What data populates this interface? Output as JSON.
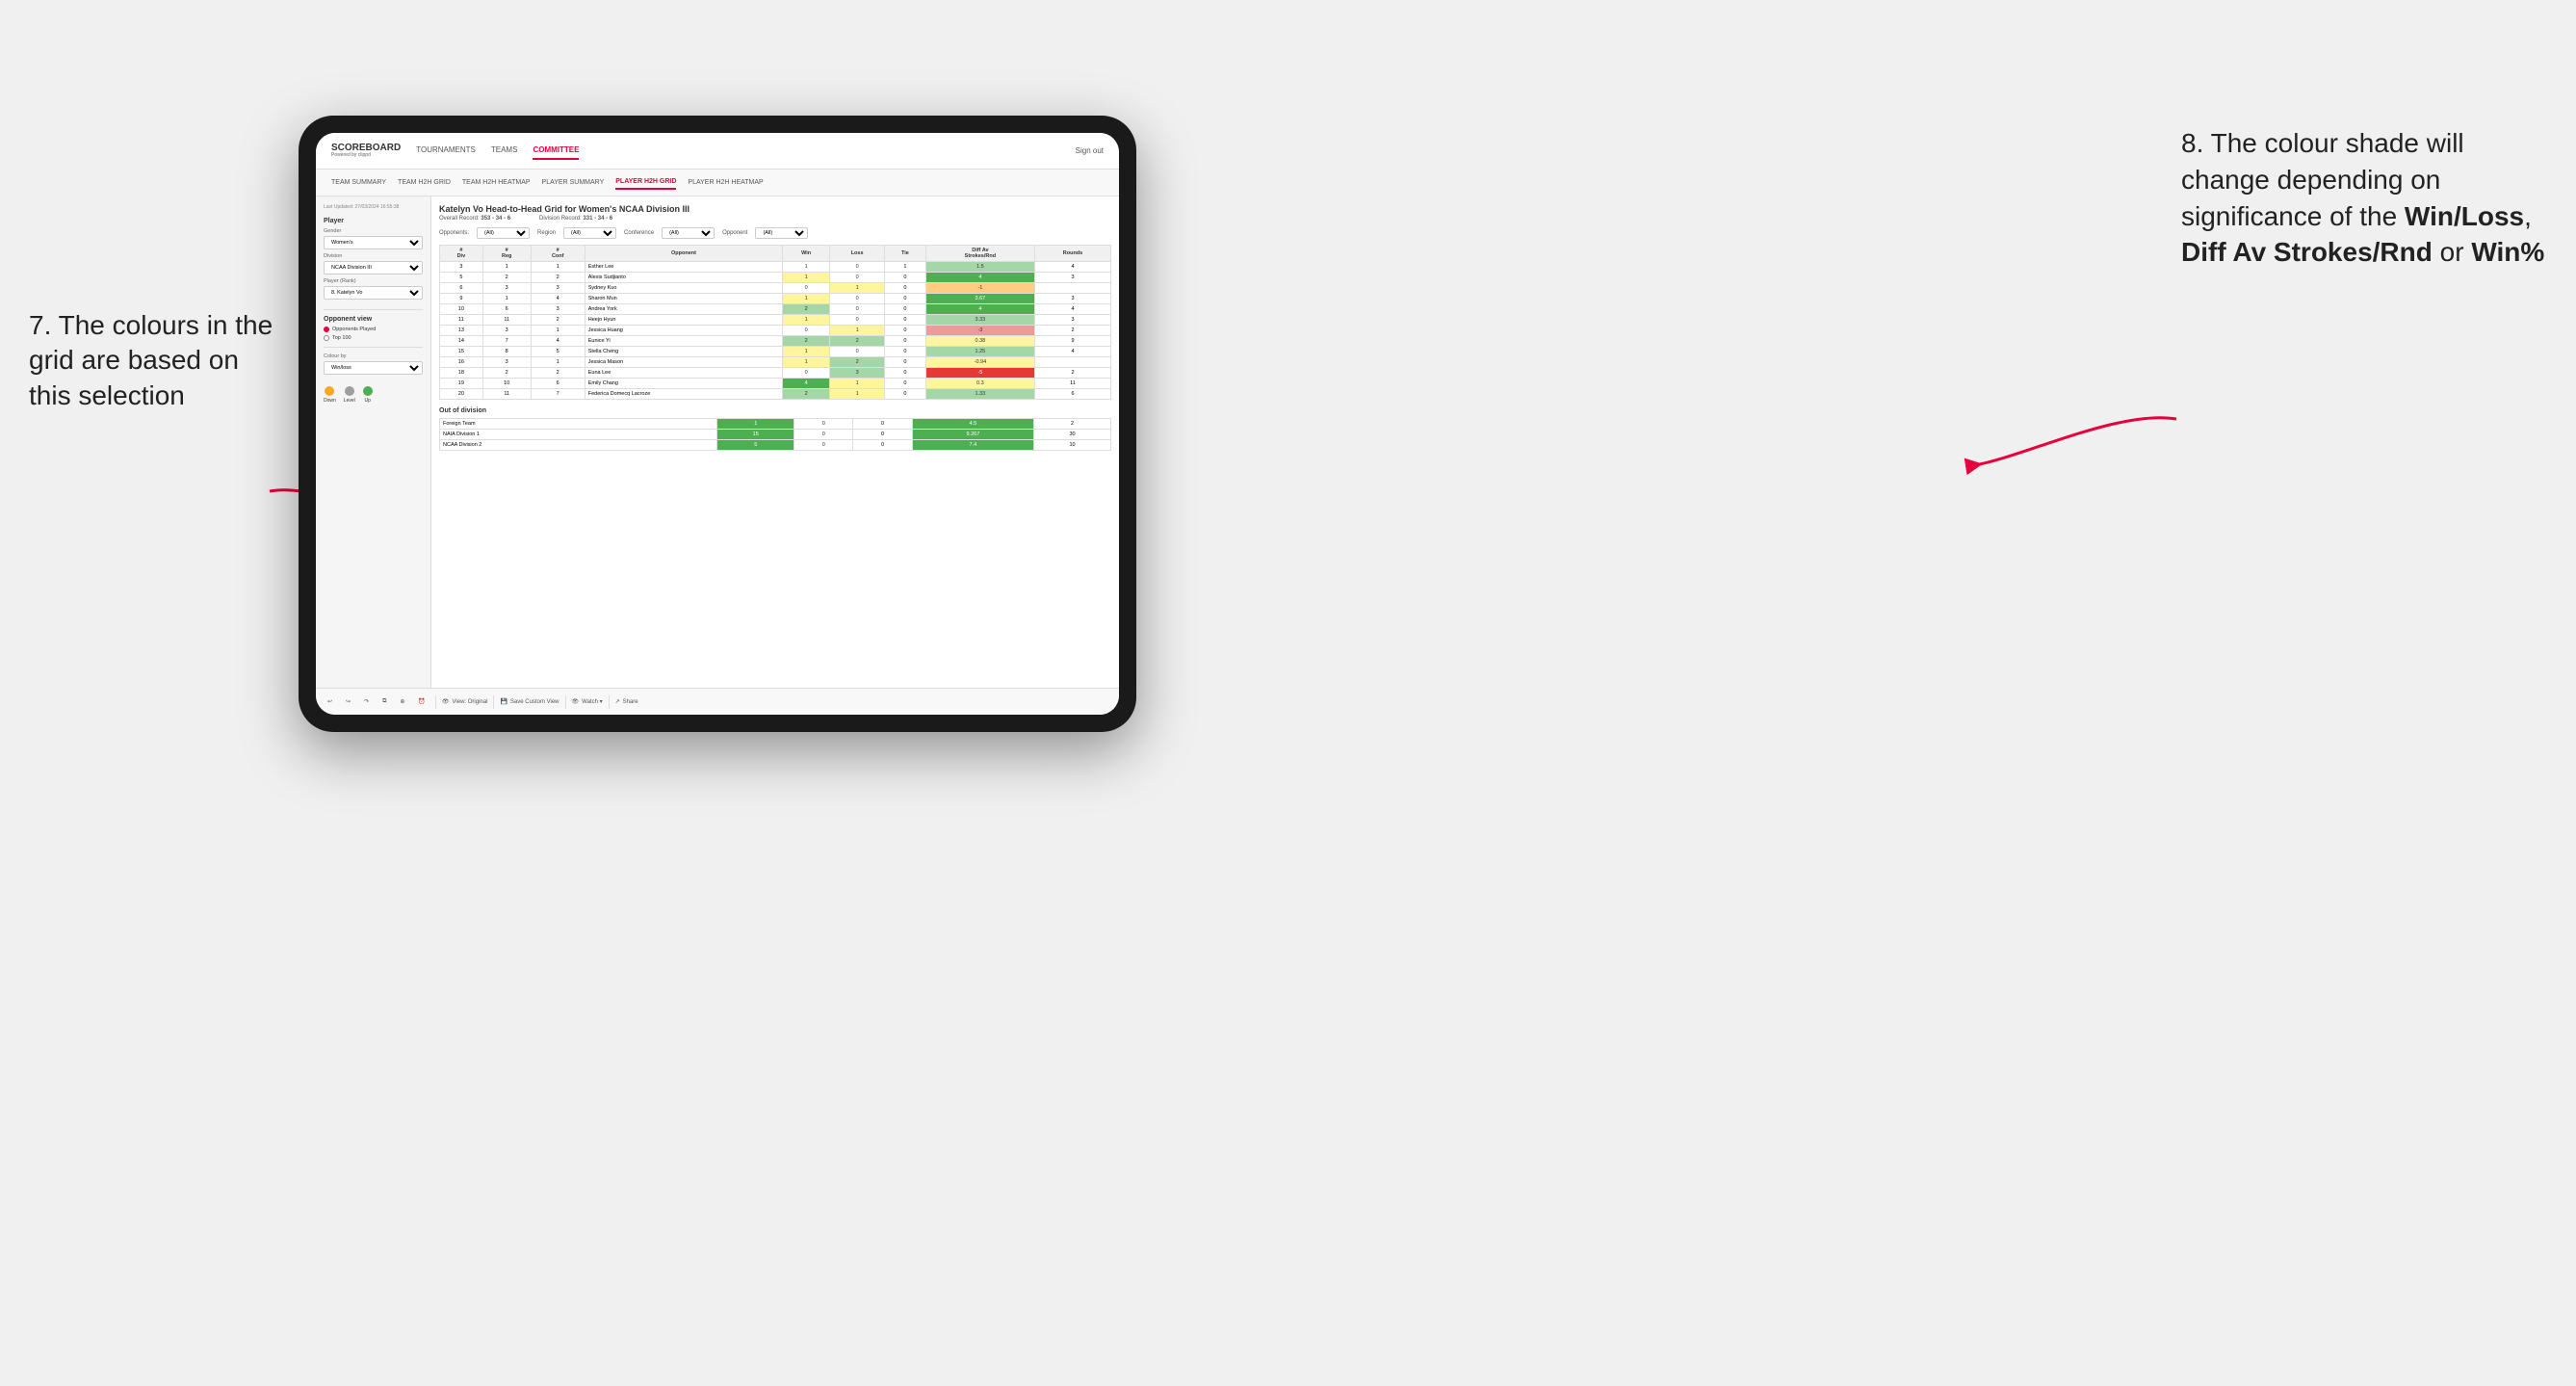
{
  "annotations": {
    "left": "7. The colours in the grid are based on this selection",
    "right_prefix": "8. The colour shade will change depending on significance of the ",
    "right_bold1": "Win/Loss",
    "right_comma": ", ",
    "right_bold2": "Diff Av Strokes/Rnd",
    "right_or": " or ",
    "right_bold3": "Win%"
  },
  "nav": {
    "logo": "SCOREBOARD",
    "logo_sub": "Powered by clippd",
    "items": [
      "TOURNAMENTS",
      "TEAMS",
      "COMMITTEE"
    ],
    "active": "COMMITTEE",
    "sign_in": "Sign out"
  },
  "sub_nav": {
    "items": [
      "TEAM SUMMARY",
      "TEAM H2H GRID",
      "TEAM H2H HEATMAP",
      "PLAYER SUMMARY",
      "PLAYER H2H GRID",
      "PLAYER H2H HEATMAP"
    ],
    "active": "PLAYER H2H GRID"
  },
  "left_panel": {
    "timestamp": "Last Updated: 27/03/2024 16:55:38",
    "player_section": "Player",
    "gender_label": "Gender",
    "gender_value": "Women's",
    "division_label": "Division",
    "division_value": "NCAA Division III",
    "player_rank_label": "Player (Rank)",
    "player_rank_value": "8. Katelyn Vo",
    "opponent_view_label": "Opponent view",
    "radio1": "Opponents Played",
    "radio2": "Top 100",
    "colour_by_label": "Colour by",
    "colour_by_value": "Win/loss",
    "legend": {
      "down_label": "Down",
      "level_label": "Level",
      "up_label": "Up",
      "down_color": "#f9a825",
      "level_color": "#9e9e9e",
      "up_color": "#4caf50"
    }
  },
  "grid": {
    "title": "Katelyn Vo Head-to-Head Grid for Women's NCAA Division III",
    "overall_record": "353 - 34 - 6",
    "division_record": "331 - 34 - 6",
    "filter_opponents_label": "Opponents:",
    "filter_region_label": "Region",
    "filter_conference_label": "Conference",
    "filter_opponent_label": "Opponent",
    "filter_all": "(All)",
    "table_headers": {
      "div": "#\nDiv",
      "reg": "#\nReg",
      "conf": "#\nConf",
      "opponent": "Opponent",
      "win": "Win",
      "loss": "Loss",
      "tie": "Tie",
      "diff_av": "Diff Av\nStrokes/Rnd",
      "rounds": "Rounds"
    },
    "rows": [
      {
        "div": 3,
        "reg": 1,
        "conf": 1,
        "opponent": "Esther Lee",
        "win": 1,
        "loss": 0,
        "tie": 1,
        "diff": 1.5,
        "rounds": 4,
        "win_color": "white",
        "loss_color": "white",
        "diff_color": "green-light"
      },
      {
        "div": 5,
        "reg": 2,
        "conf": 2,
        "opponent": "Alexis Sudjianto",
        "win": 1,
        "loss": 0,
        "tie": 0,
        "diff": 4.0,
        "rounds": 3,
        "win_color": "yellow",
        "loss_color": "white",
        "diff_color": "green-dark"
      },
      {
        "div": 6,
        "reg": 3,
        "conf": 3,
        "opponent": "Sydney Kuo",
        "win": 0,
        "loss": 1,
        "tie": 0,
        "diff": -1.0,
        "rounds": "",
        "win_color": "white",
        "loss_color": "yellow",
        "diff_color": "orange"
      },
      {
        "div": 9,
        "reg": 1,
        "conf": 4,
        "opponent": "Sharon Mun",
        "win": 1,
        "loss": 0,
        "tie": 0,
        "diff": 3.67,
        "rounds": 3,
        "win_color": "yellow",
        "loss_color": "white",
        "diff_color": "green-dark"
      },
      {
        "div": 10,
        "reg": 6,
        "conf": 3,
        "opponent": "Andrea York",
        "win": 2,
        "loss": 0,
        "tie": 0,
        "diff": 4.0,
        "rounds": 4,
        "win_color": "green-light",
        "loss_color": "white",
        "diff_color": "green-dark"
      },
      {
        "div": 11,
        "reg": 11,
        "conf": 2,
        "opponent": "Heejo Hyun",
        "win": 1,
        "loss": 0,
        "tie": 0,
        "diff": 3.33,
        "rounds": 3,
        "win_color": "yellow",
        "loss_color": "white",
        "diff_color": "green-light"
      },
      {
        "div": 13,
        "reg": 3,
        "conf": 1,
        "opponent": "Jessica Huang",
        "win": 0,
        "loss": 1,
        "tie": 0,
        "diff": -3.0,
        "rounds": 2,
        "win_color": "white",
        "loss_color": "yellow",
        "diff_color": "red-light"
      },
      {
        "div": 14,
        "reg": 7,
        "conf": 4,
        "opponent": "Eunice Yi",
        "win": 2,
        "loss": 2,
        "tie": 0,
        "diff": 0.38,
        "rounds": 9,
        "win_color": "green-light",
        "loss_color": "green-light",
        "diff_color": "yellow"
      },
      {
        "div": 15,
        "reg": 8,
        "conf": 5,
        "opponent": "Stella Cheng",
        "win": 1,
        "loss": 0,
        "tie": 0,
        "diff": 1.25,
        "rounds": 4,
        "win_color": "yellow",
        "loss_color": "white",
        "diff_color": "green-light"
      },
      {
        "div": 16,
        "reg": 3,
        "conf": 1,
        "opponent": "Jessica Mason",
        "win": 1,
        "loss": 2,
        "tie": 0,
        "diff": -0.94,
        "rounds": "",
        "win_color": "yellow",
        "loss_color": "green-light",
        "diff_color": "yellow"
      },
      {
        "div": 18,
        "reg": 2,
        "conf": 2,
        "opponent": "Euna Lee",
        "win": 0,
        "loss": 3,
        "tie": 0,
        "diff": -5.0,
        "rounds": 2,
        "win_color": "white",
        "loss_color": "green-light",
        "diff_color": "red-dark"
      },
      {
        "div": 19,
        "reg": 10,
        "conf": 6,
        "opponent": "Emily Chang",
        "win": 4,
        "loss": 1,
        "tie": 0,
        "diff": 0.3,
        "rounds": 11,
        "win_color": "green-dark",
        "loss_color": "yellow",
        "diff_color": "yellow"
      },
      {
        "div": 20,
        "reg": 11,
        "conf": 7,
        "opponent": "Federica Domecq Lacroze",
        "win": 2,
        "loss": 1,
        "tie": 0,
        "diff": 1.33,
        "rounds": 6,
        "win_color": "green-light",
        "loss_color": "yellow",
        "diff_color": "green-light"
      }
    ],
    "out_of_division_label": "Out of division",
    "out_rows": [
      {
        "opponent": "Foreign Team",
        "win": 1,
        "loss": 0,
        "tie": 0,
        "diff": 4.5,
        "rounds": 2,
        "diff_color": "green-dark"
      },
      {
        "opponent": "NAIA Division 1",
        "win": 15,
        "loss": 0,
        "tie": 0,
        "diff": 9.267,
        "rounds": 30,
        "diff_color": "green-dark"
      },
      {
        "opponent": "NCAA Division 2",
        "win": 5,
        "loss": 0,
        "tie": 0,
        "diff": 7.4,
        "rounds": 10,
        "diff_color": "green-dark"
      }
    ]
  },
  "toolbar": {
    "view_original": "View: Original",
    "save_custom": "Save Custom View",
    "watch": "Watch ▾",
    "share": "Share"
  }
}
